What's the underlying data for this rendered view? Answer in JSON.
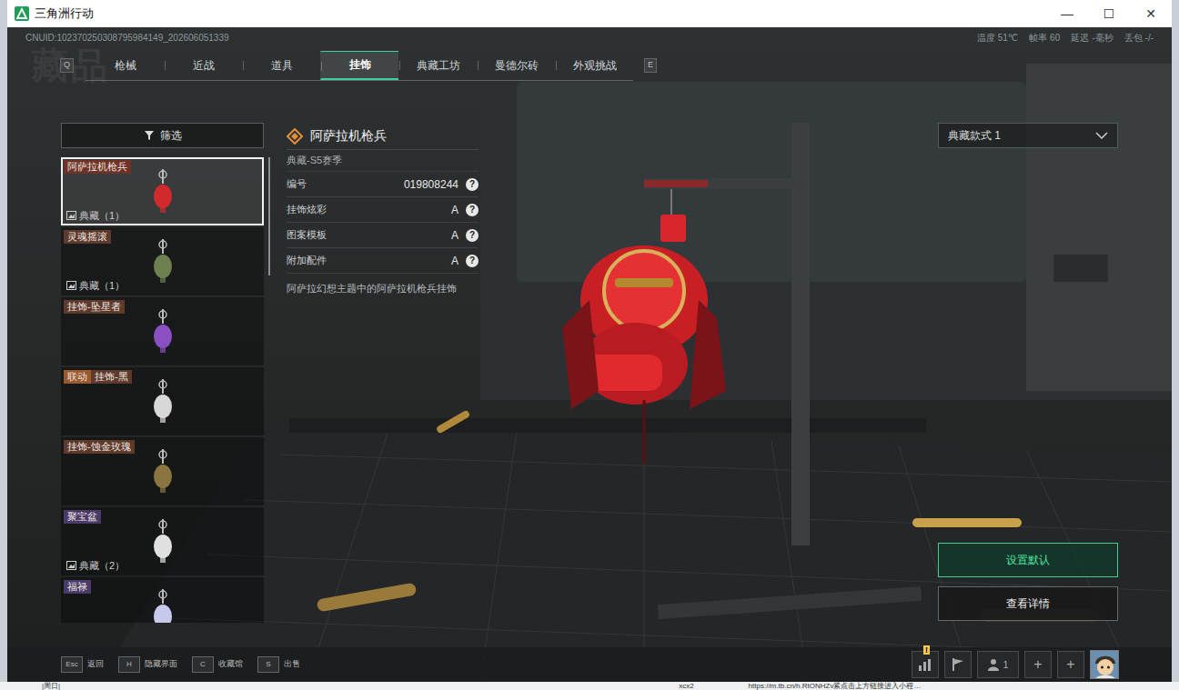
{
  "window": {
    "title": "三角洲行动",
    "controls": [
      "—",
      "☐",
      "✕"
    ]
  },
  "hud": {
    "uid": "CNUID:102370250308795984149_202606051339",
    "stats": [
      {
        "label": "温度",
        "value": "51℃"
      },
      {
        "label": "帧率",
        "value": "60"
      },
      {
        "label": "延迟",
        "value": "-毫秒"
      },
      {
        "label": "丢包",
        "value": "-/-"
      }
    ]
  },
  "page_heading": "藏品",
  "tab_keys": {
    "prev": "Q",
    "next": "E"
  },
  "tabs": [
    {
      "label": "枪械",
      "selected": false
    },
    {
      "label": "近战",
      "selected": false
    },
    {
      "label": "道具",
      "selected": false
    },
    {
      "label": "挂饰",
      "selected": true
    },
    {
      "label": "典藏工坊",
      "selected": false
    },
    {
      "label": "曼德尔砖",
      "selected": false
    },
    {
      "label": "外观挑战",
      "selected": false
    }
  ],
  "filter": {
    "label": "筛选"
  },
  "items": [
    {
      "name": "阿萨拉机枪兵",
      "badge": "典藏（1）",
      "selected": true,
      "color": "#6e3226"
    },
    {
      "name": "灵魂摇滚",
      "badge": "典藏（1）",
      "selected": false,
      "color": "#5e3a2c"
    },
    {
      "name": "挂饰-坠星者",
      "selected": false,
      "color": "#5e3a2c"
    },
    {
      "name": "挂饰-黑",
      "tag": "联动",
      "selected": false,
      "color": "#5e3a2c"
    },
    {
      "name": "挂饰-蚀金玫瑰",
      "selected": false,
      "color": "#5e3a2c"
    },
    {
      "name": "聚宝盆",
      "badge": "典藏（2）",
      "selected": false,
      "color": "#4a3a6a"
    },
    {
      "name": "福禄",
      "selected": false,
      "color": "#4a3a6a"
    }
  ],
  "detail": {
    "title": "阿萨拉机枪兵",
    "season": "典藏-S5赛季",
    "attributes": [
      {
        "label": "编号",
        "value": "019808244",
        "help": "?"
      },
      {
        "label": "挂饰炫彩",
        "value": "A",
        "help": "?"
      },
      {
        "label": "图案模板",
        "value": "A",
        "help": "?"
      },
      {
        "label": "附加配件",
        "value": "A",
        "help": "?"
      }
    ],
    "description": "阿萨拉幻想主题中的阿萨拉机枪兵挂饰"
  },
  "style_select": {
    "value": "典藏款式 1"
  },
  "actions": [
    {
      "label": "设置默认",
      "kind": "primary"
    },
    {
      "label": "查看详情",
      "kind": "secondary"
    }
  ],
  "hotkeys": [
    {
      "key": "Esc",
      "label": "返回"
    },
    {
      "key": "H",
      "label": "隐藏界面"
    },
    {
      "key": "C",
      "label": "收藏馆"
    },
    {
      "key": "S",
      "label": "出售"
    }
  ],
  "social": {
    "alert": "!",
    "friends": "1",
    "slots": [
      "+",
      "+"
    ]
  },
  "desktop": {
    "texts": [
      "|周日|",
      "xcx2",
      "https://m.tb.cn/h.RtONHZv紧点击上方链接进入小程…"
    ]
  }
}
